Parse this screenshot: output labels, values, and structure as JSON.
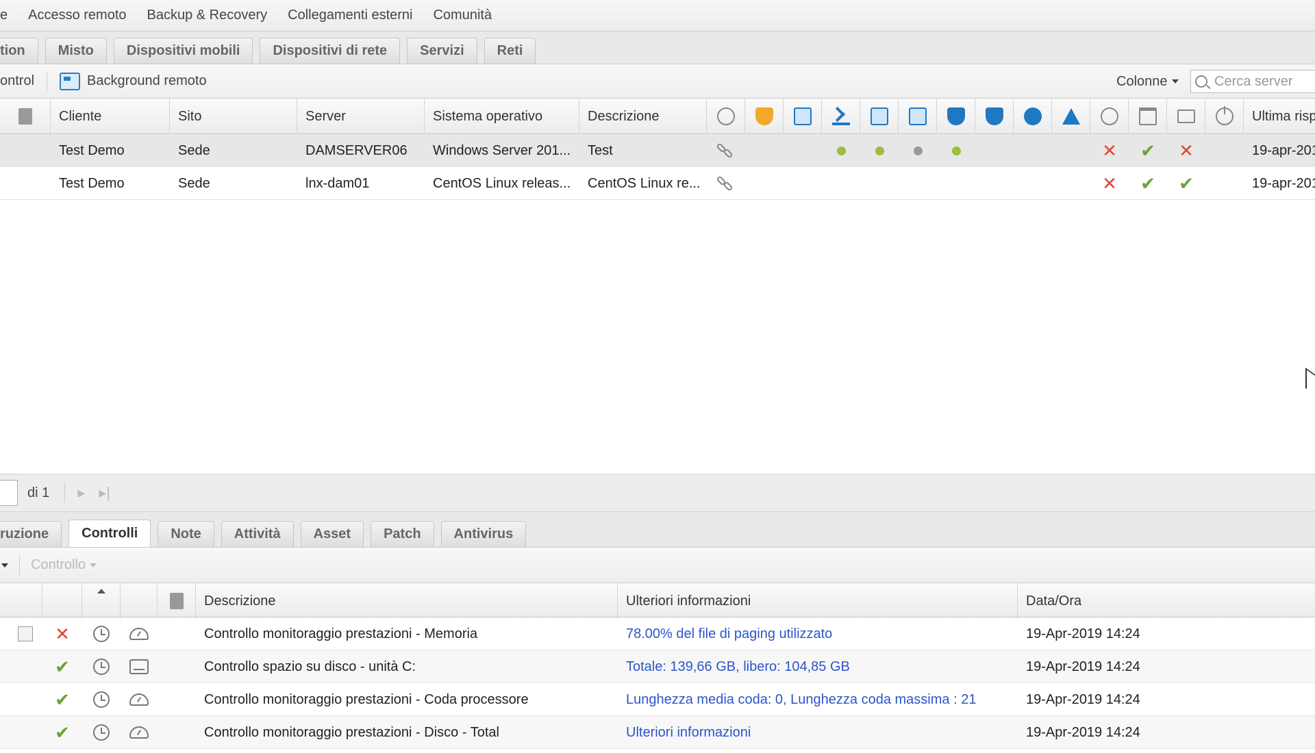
{
  "menu": [
    "e",
    "Accesso remoto",
    "Backup & Recovery",
    "Collegamenti esterni",
    "Comunità"
  ],
  "tabs": [
    "tion",
    "Misto",
    "Dispositivi mobili",
    "Dispositivi di rete",
    "Servizi",
    "Reti"
  ],
  "toolbar": {
    "control_label": "ontrol",
    "background_label": "Background remoto",
    "columns_label": "Colonne",
    "search_placeholder": "Cerca server"
  },
  "grid": {
    "headers": [
      "Cliente",
      "Sito",
      "Server",
      "Sistema operativo",
      "Descrizione",
      "Ultima risp"
    ],
    "rows": [
      {
        "cliente": "Test Demo",
        "sito": "Sede",
        "server": "DAMSERVER06",
        "os": "Windows Server 201...",
        "descrizione": "Test",
        "ultima": "19-apr-201"
      },
      {
        "cliente": "Test Demo",
        "sito": "Sede",
        "server": "lnx-dam01",
        "os": "CentOS Linux releas...",
        "descrizione": "CentOS Linux re...",
        "ultima": "19-apr-201"
      }
    ],
    "header_icons": [
      "sync-icon",
      "antivirus-shield-icon",
      "backup-icon",
      "satellite-icon",
      "terminal-icon",
      "patch-icon",
      "security-shield-icon",
      "protection-shield-icon",
      "support-icon",
      "cone-icon",
      "clock-icon",
      "calendar-icon",
      "monitor-icon",
      "power-icon"
    ]
  },
  "pager": {
    "of_label": "di 1"
  },
  "bottom_tabs": [
    "ruzione",
    "Controlli",
    "Note",
    "Attività",
    "Asset",
    "Patch",
    "Antivirus"
  ],
  "bottom_toolbar": {
    "controllo_label": "Controllo"
  },
  "checks": {
    "headers": [
      "Descrizione",
      "Ulteriori informazioni",
      "Data/Ora"
    ],
    "rows": [
      {
        "descrizione": "Controllo monitoraggio prestazioni - Memoria",
        "info": "78.00% del file di paging utilizzato",
        "data": "19-Apr-2019 14:24"
      },
      {
        "descrizione": "Controllo spazio su disco - unità C:",
        "info": "Totale: 139,66 GB, libero: 104,85 GB",
        "data": "19-Apr-2019 14:24"
      },
      {
        "descrizione": "Controllo monitoraggio prestazioni - Coda processore",
        "info": "Lunghezza media coda: 0, Lunghezza coda massima : 21",
        "data": "19-Apr-2019 14:24"
      },
      {
        "descrizione": "Controllo monitoraggio prestazioni - Disco - Total",
        "info": "Ulteriori informazioni",
        "data": "19-Apr-2019 14:24"
      }
    ]
  },
  "colors": {
    "accent_blue": "#1f78c2",
    "status_green": "#69a530",
    "status_red": "#e0473a",
    "link_blue": "#2b56c9"
  }
}
